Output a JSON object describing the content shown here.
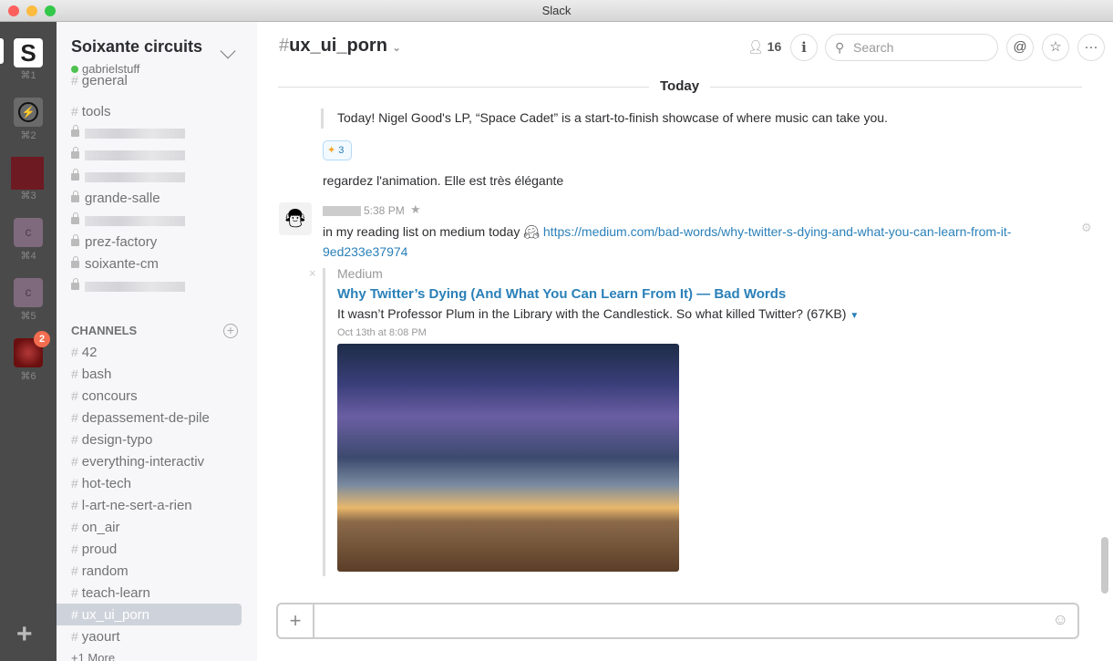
{
  "window": {
    "title": "Slack"
  },
  "teams": [
    {
      "key": "⌘1",
      "initial": "S"
    },
    {
      "key": "⌘2"
    },
    {
      "key": "⌘3"
    },
    {
      "key": "⌘4",
      "initial": "c"
    },
    {
      "key": "⌘5",
      "initial": "c"
    },
    {
      "key": "⌘6",
      "badge": "2"
    }
  ],
  "sidebar": {
    "team_name": "Soixante circuits",
    "user": "gabrielstuff",
    "top_items": [
      {
        "type": "hash",
        "label": "general"
      },
      {
        "type": "hash",
        "label": "tools"
      },
      {
        "type": "lock",
        "label": ""
      },
      {
        "type": "lock",
        "label": ""
      },
      {
        "type": "lock",
        "label": ""
      },
      {
        "type": "lock",
        "label": "grande-salle"
      },
      {
        "type": "lock",
        "label": ""
      },
      {
        "type": "lock",
        "label": "prez-factory"
      },
      {
        "type": "lock",
        "label": "soixante-cm"
      },
      {
        "type": "lock",
        "label": ""
      }
    ],
    "channels_header": "CHANNELS",
    "channels": [
      "42",
      "bash",
      "concours",
      "depassement-de-pile",
      "design-typo",
      "everything-interactiv",
      "hot-tech",
      "l-art-ne-sert-a-rien",
      "on_air",
      "proud",
      "random",
      "teach-learn",
      "ux_ui_porn",
      "yaourt"
    ],
    "more": "+1 More"
  },
  "header": {
    "channel": "ux_ui_porn",
    "members": "16",
    "search_placeholder": "Search"
  },
  "messages": {
    "date_divider": "Today",
    "quote": "Today! Nigel Good's LP, “Space Cadet” is a start-to-finish showcase of where music can take you.",
    "reaction_count": "3",
    "msg1": "regardez l'animation. Elle est très élégante",
    "time": "5:38 PM",
    "msg2_text": "in my reading list on medium today",
    "msg2_link": "https://medium.com/bad-words/why-twitter-s-dying-and-what-you-can-learn-from-it-9ed233e37974",
    "attachment": {
      "service": "Medium",
      "title": "Why Twitter’s Dying (And What You Can Learn From It) — Bad Words",
      "description": "It wasn’t Professor Plum in the Library with the Candlestick. So what killed Twitter? (67KB)",
      "date": "Oct 13th at 8:08 PM"
    }
  },
  "colors": {
    "link": "#2a80b9",
    "sidebar": "#f7f7f9",
    "teams": "#4a4a4a"
  }
}
